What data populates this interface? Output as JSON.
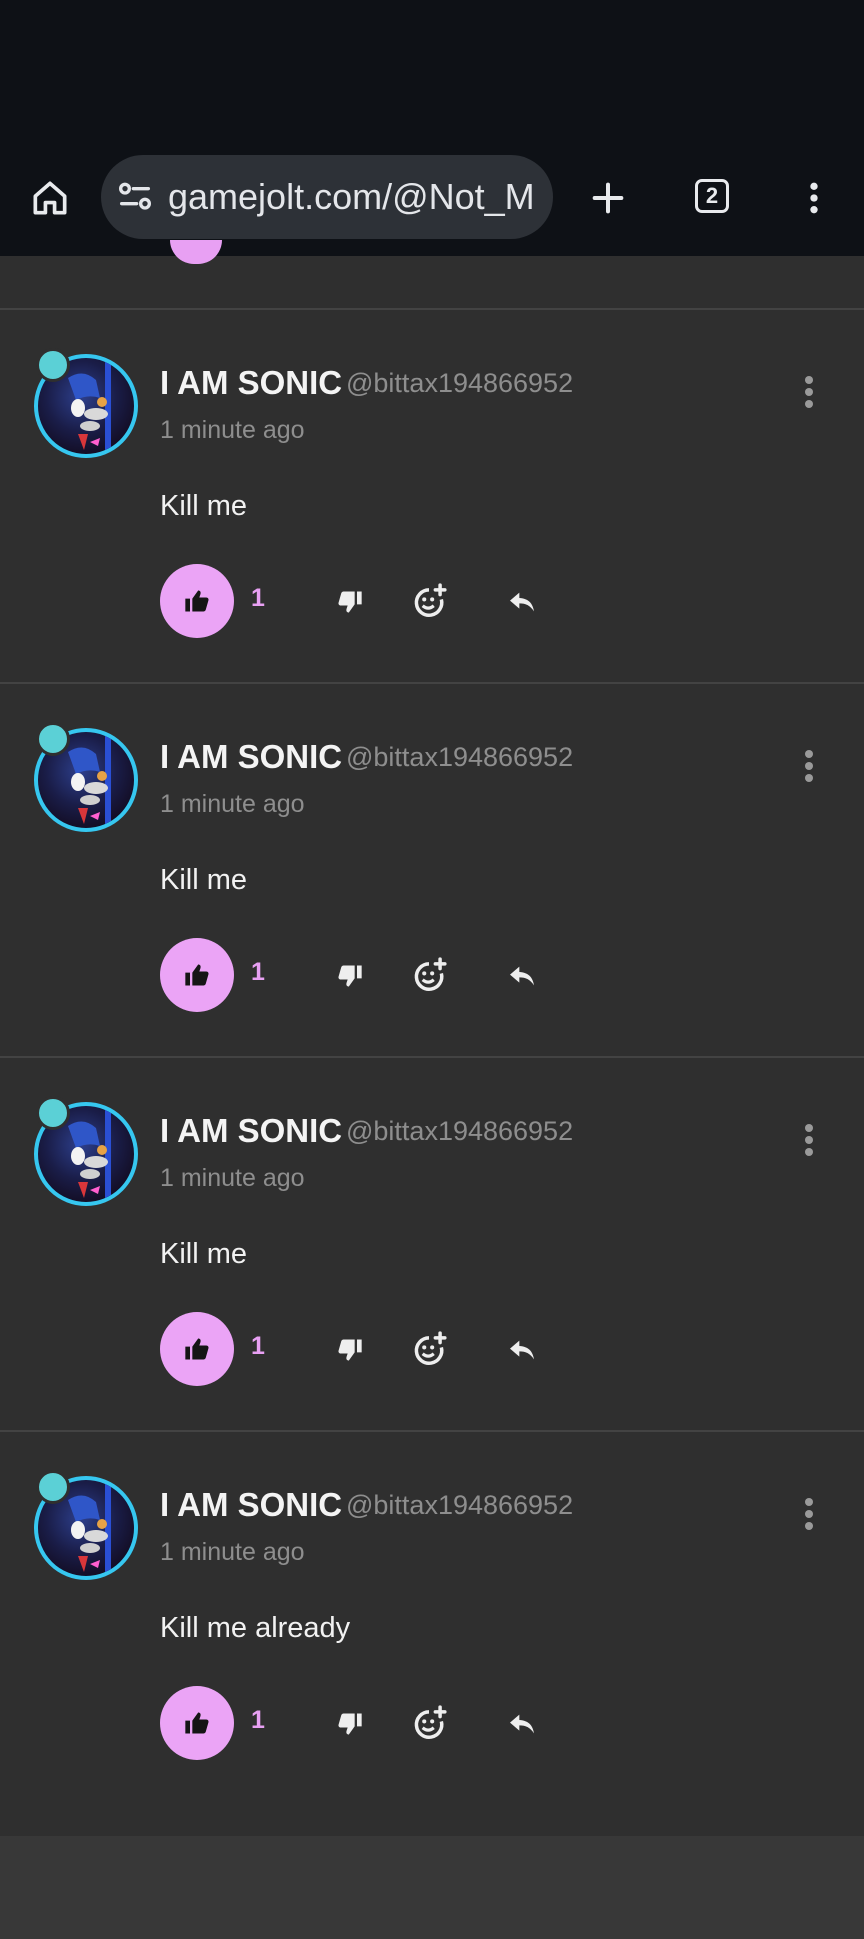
{
  "browser": {
    "url_text": "gamejolt.com/@Not_Ma",
    "tab_count": "2"
  },
  "comments": [
    {
      "username": "I AM SONIC",
      "handle": "@bittax194866952",
      "time": "1 minute ago",
      "text": "Kill me",
      "likes": "1"
    },
    {
      "username": "I AM SONIC",
      "handle": "@bittax194866952",
      "time": "1 minute ago",
      "text": "Kill me",
      "likes": "1"
    },
    {
      "username": "I AM SONIC",
      "handle": "@bittax194866952",
      "time": "1 minute ago",
      "text": "Kill me",
      "likes": "1"
    },
    {
      "username": "I AM SONIC",
      "handle": "@bittax194866952",
      "time": "1 minute ago",
      "text": "Kill me already",
      "likes": "1"
    }
  ],
  "colors": {
    "accent_like": "#eba4f6",
    "avatar_ring": "#36c7f0",
    "background": "#2f2f2f",
    "toolbar": "#0e1116"
  }
}
